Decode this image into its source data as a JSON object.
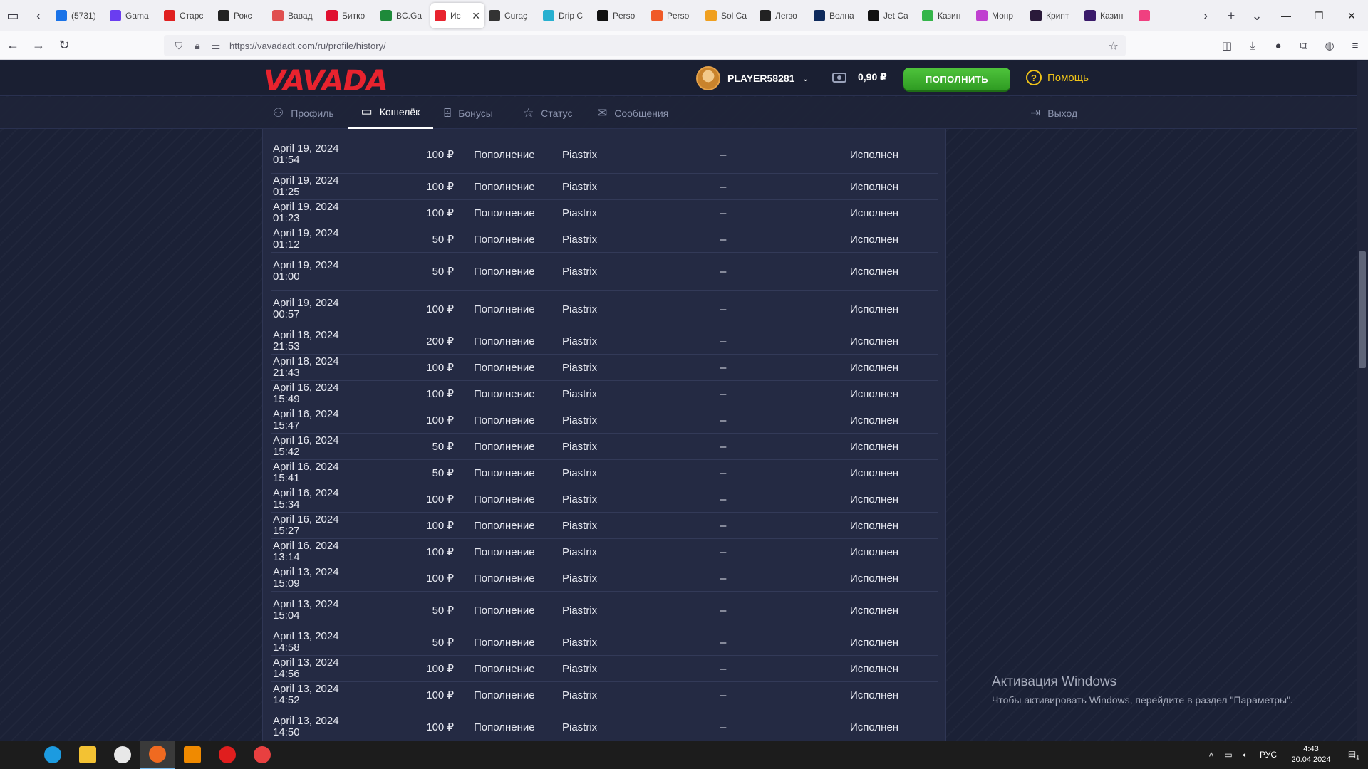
{
  "browser": {
    "tabs": [
      {
        "label": "(5731)",
        "icon": "mail-icon",
        "color": "#1a73e8"
      },
      {
        "label": "Gama",
        "icon": "gama-icon",
        "color": "#6a3df0"
      },
      {
        "label": "Старс",
        "icon": "s-icon",
        "color": "#e02020"
      },
      {
        "label": "Рокс",
        "icon": "rox-icon",
        "color": "#222222"
      },
      {
        "label": "Вавад",
        "icon": "gift-icon",
        "color": "#e05050"
      },
      {
        "label": "Битко",
        "icon": "star-icon",
        "color": "#e01030"
      },
      {
        "label": "BC.Ga",
        "icon": "bc-icon",
        "color": "#1e8a3a"
      },
      {
        "label": "Ис",
        "icon": "vavada-icon",
        "color": "#e8232e",
        "active": true
      },
      {
        "label": "Curaç",
        "icon": "shield-icon",
        "color": "#333333"
      },
      {
        "label": "Drip C",
        "icon": "drip-icon",
        "color": "#28b0d0"
      },
      {
        "label": "Perso",
        "icon": "p-icon",
        "color": "#111111"
      },
      {
        "label": "Perso",
        "icon": "swirl-icon",
        "color": "#f05a28"
      },
      {
        "label": "Sol Ca",
        "icon": "sun-icon",
        "color": "#f0a020"
      },
      {
        "label": "Легзо",
        "icon": "g-icon",
        "color": "#222222"
      },
      {
        "label": "Волна",
        "icon": "v-icon",
        "color": "#0e2a5c"
      },
      {
        "label": "Jet Ca",
        "icon": "jet-icon",
        "color": "#111111"
      },
      {
        "label": "Казин",
        "icon": "f-icon",
        "color": "#35b54a"
      },
      {
        "label": "Монр",
        "icon": "heart-icon",
        "color": "#c040d0"
      },
      {
        "label": "Крипт",
        "icon": "k-icon",
        "color": "#2a1a3a"
      },
      {
        "label": "Казин",
        "icon": "casino-icon",
        "color": "#3a1a6a"
      },
      {
        "label": "",
        "icon": "flower-icon",
        "color": "#f04080"
      }
    ],
    "active_tab_close": "✕",
    "url": "https://vavadadt.com/ru/profile/history/"
  },
  "site": {
    "logo": "VAVADA",
    "username": "PLAYER58281",
    "balance": "0,90 ₽",
    "deposit_label": "ПОПОЛНИТЬ",
    "help_label": "Помощь",
    "accent": "#e8232e",
    "deposit_color": "#3bb02c",
    "help_color": "#f0c419"
  },
  "profile_nav": [
    {
      "label": "Профиль",
      "icon": "user-icon"
    },
    {
      "label": "Кошелёк",
      "icon": "wallet-icon",
      "active": true
    },
    {
      "label": "Бонусы",
      "icon": "gift-icon"
    },
    {
      "label": "Статус",
      "icon": "star-icon"
    },
    {
      "label": "Сообщения",
      "icon": "mail-icon"
    }
  ],
  "logout_label": "Выход",
  "history": [
    {
      "date": "April 19, 2024 01:54",
      "amount": "100 ₽",
      "type": "Пополнение",
      "system": "Piastrix",
      "detail": "–",
      "status": "Исполнен"
    },
    {
      "date": "April 19, 2024 01:25",
      "amount": "100 ₽",
      "type": "Пополнение",
      "system": "Piastrix",
      "detail": "–",
      "status": "Исполнен"
    },
    {
      "date": "April 19, 2024 01:23",
      "amount": "100 ₽",
      "type": "Пополнение",
      "system": "Piastrix",
      "detail": "–",
      "status": "Исполнен"
    },
    {
      "date": "April 19, 2024 01:12",
      "amount": "50 ₽",
      "type": "Пополнение",
      "system": "Piastrix",
      "detail": "–",
      "status": "Исполнен"
    },
    {
      "date": "April 19, 2024 01:00",
      "amount": "50 ₽",
      "type": "Пополнение",
      "system": "Piastrix",
      "detail": "–",
      "status": "Исполнен"
    },
    {
      "date": "April 19, 2024 00:57",
      "amount": "100 ₽",
      "type": "Пополнение",
      "system": "Piastrix",
      "detail": "–",
      "status": "Исполнен"
    },
    {
      "date": "April 18, 2024 21:53",
      "amount": "200 ₽",
      "type": "Пополнение",
      "system": "Piastrix",
      "detail": "–",
      "status": "Исполнен"
    },
    {
      "date": "April 18, 2024 21:43",
      "amount": "100 ₽",
      "type": "Пополнение",
      "system": "Piastrix",
      "detail": "–",
      "status": "Исполнен"
    },
    {
      "date": "April 16, 2024 15:49",
      "amount": "100 ₽",
      "type": "Пополнение",
      "system": "Piastrix",
      "detail": "–",
      "status": "Исполнен"
    },
    {
      "date": "April 16, 2024 15:47",
      "amount": "100 ₽",
      "type": "Пополнение",
      "system": "Piastrix",
      "detail": "–",
      "status": "Исполнен"
    },
    {
      "date": "April 16, 2024 15:42",
      "amount": "50 ₽",
      "type": "Пополнение",
      "system": "Piastrix",
      "detail": "–",
      "status": "Исполнен"
    },
    {
      "date": "April 16, 2024 15:41",
      "amount": "50 ₽",
      "type": "Пополнение",
      "system": "Piastrix",
      "detail": "–",
      "status": "Исполнен"
    },
    {
      "date": "April 16, 2024 15:34",
      "amount": "100 ₽",
      "type": "Пополнение",
      "system": "Piastrix",
      "detail": "–",
      "status": "Исполнен"
    },
    {
      "date": "April 16, 2024 15:27",
      "amount": "100 ₽",
      "type": "Пополнение",
      "system": "Piastrix",
      "detail": "–",
      "status": "Исполнен"
    },
    {
      "date": "April 16, 2024 13:14",
      "amount": "100 ₽",
      "type": "Пополнение",
      "system": "Piastrix",
      "detail": "–",
      "status": "Исполнен"
    },
    {
      "date": "April 13, 2024 15:09",
      "amount": "100 ₽",
      "type": "Пополнение",
      "system": "Piastrix",
      "detail": "–",
      "status": "Исполнен"
    },
    {
      "date": "April 13, 2024 15:04",
      "amount": "50 ₽",
      "type": "Пополнение",
      "system": "Piastrix",
      "detail": "–",
      "status": "Исполнен"
    },
    {
      "date": "April 13, 2024 14:58",
      "amount": "50 ₽",
      "type": "Пополнение",
      "system": "Piastrix",
      "detail": "–",
      "status": "Исполнен"
    },
    {
      "date": "April 13, 2024 14:56",
      "amount": "100 ₽",
      "type": "Пополнение",
      "system": "Piastrix",
      "detail": "–",
      "status": "Исполнен"
    },
    {
      "date": "April 13, 2024 14:52",
      "amount": "100 ₽",
      "type": "Пополнение",
      "system": "Piastrix",
      "detail": "–",
      "status": "Исполнен"
    },
    {
      "date": "April 13, 2024 14:50",
      "amount": "100 ₽",
      "type": "Пополнение",
      "system": "Piastrix",
      "detail": "–",
      "status": "Исполнен"
    }
  ],
  "windows_activation": {
    "title": "Активация Windows",
    "subtitle": "Чтобы активировать Windows, перейдите в раздел \"Параметры\"."
  },
  "taskbar": {
    "apps": [
      {
        "icon": "edge-icon",
        "color": "#1c9be0"
      },
      {
        "icon": "folder-icon",
        "color": "#f3c233"
      },
      {
        "icon": "g-hub-icon",
        "color": "#e8e8e8"
      },
      {
        "icon": "firefox-icon",
        "color": "#f06a20",
        "active": true
      },
      {
        "icon": "vlc-icon",
        "color": "#f08a00"
      },
      {
        "icon": "record-icon",
        "color": "#e01e1e"
      },
      {
        "icon": "screen-recorder-icon",
        "color": "#e84040"
      }
    ],
    "language": "РУС",
    "time": "4:43",
    "date": "20.04.2024",
    "notification_count": "1"
  }
}
